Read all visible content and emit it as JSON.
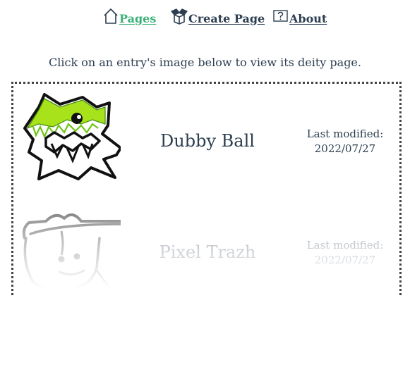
{
  "nav": {
    "pages_label": "Pages",
    "create_label": "Create Page",
    "about_label": "About",
    "active_color": "#3db07a",
    "text_color": "#2c3e50"
  },
  "intro": "Click on an entry's image below to view its deity page.",
  "entries": [
    {
      "name": "Dubby Ball",
      "modified_label": "Last modified:",
      "modified_date": "2022/07/27",
      "image": "spiky-creature-drawing"
    },
    {
      "name": "Pixel Trazh",
      "modified_label": "Last modified:",
      "modified_date": "2022/07/27",
      "image": "cap-face-drawing"
    }
  ]
}
